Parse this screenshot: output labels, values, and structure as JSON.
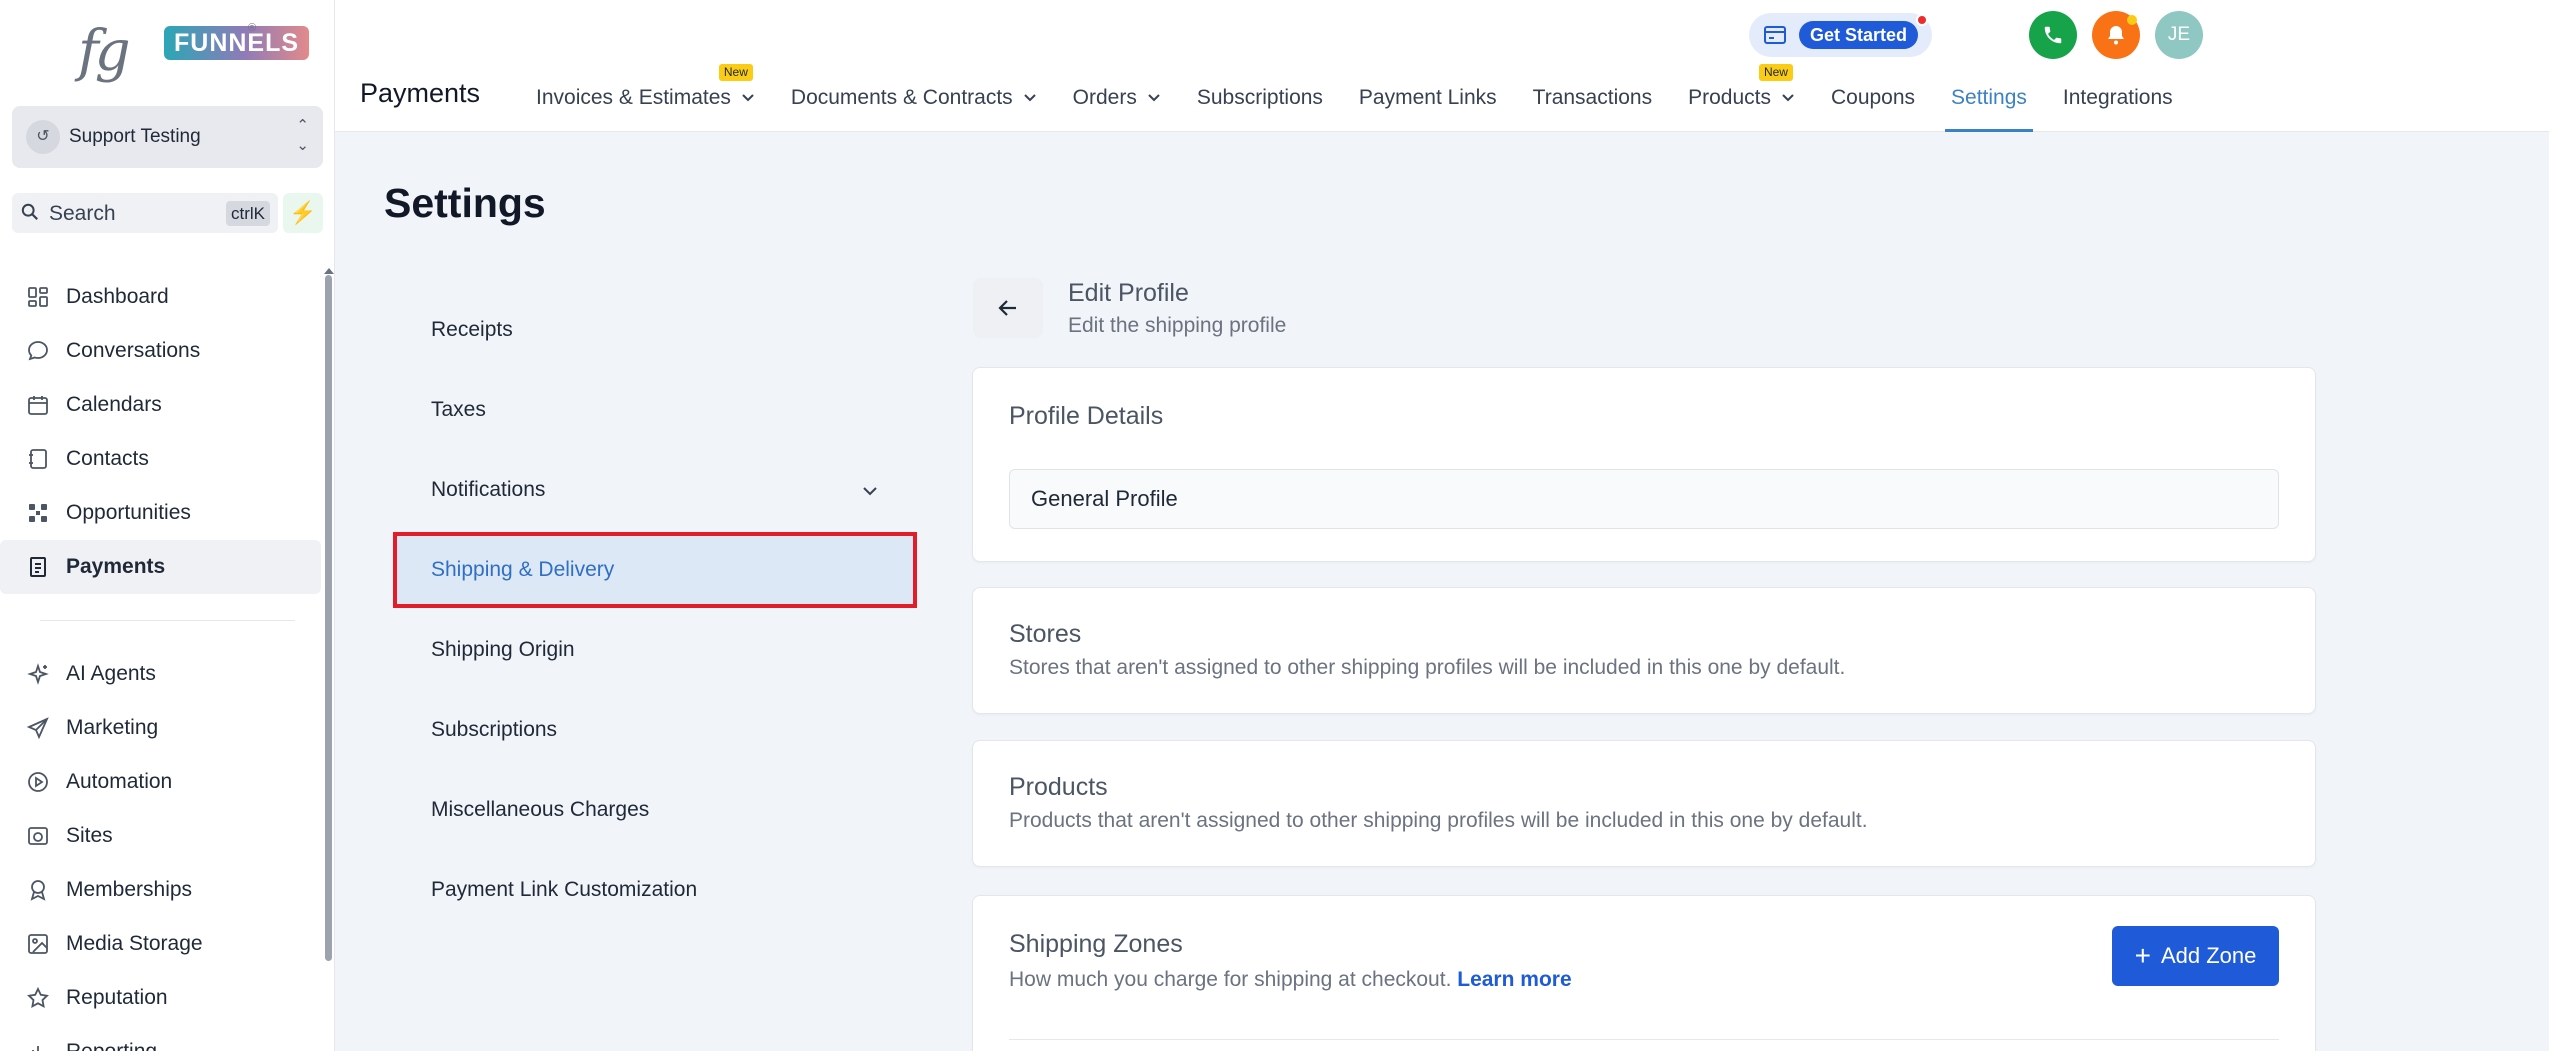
{
  "brand": {
    "logo_fg": "fg",
    "logo_word": "FUNNELS",
    "logo_reg": "®"
  },
  "account": {
    "name": "Support Testing",
    "avatar_glyph": "↺"
  },
  "search": {
    "label": "Search",
    "shortcut": "ctrlK"
  },
  "sidebar": {
    "items": [
      {
        "label": "Dashboard",
        "icon": "dashboard-icon"
      },
      {
        "label": "Conversations",
        "icon": "chat-bubble-icon"
      },
      {
        "label": "Calendars",
        "icon": "calendar-icon"
      },
      {
        "label": "Contacts",
        "icon": "contacts-book-icon"
      },
      {
        "label": "Opportunities",
        "icon": "opportunities-icon"
      },
      {
        "label": "Payments",
        "icon": "payments-icon",
        "active": true
      }
    ],
    "items2": [
      {
        "label": "AI Agents",
        "icon": "sparkle-icon"
      },
      {
        "label": "Marketing",
        "icon": "send-icon"
      },
      {
        "label": "Automation",
        "icon": "automation-icon"
      },
      {
        "label": "Sites",
        "icon": "globe-icon"
      },
      {
        "label": "Memberships",
        "icon": "badge-icon"
      },
      {
        "label": "Media Storage",
        "icon": "image-icon"
      },
      {
        "label": "Reputation",
        "icon": "star-icon"
      },
      {
        "label": "Reporting",
        "icon": "chart-icon"
      }
    ]
  },
  "topbar": {
    "module": "Payments",
    "tabs": [
      {
        "label": "Invoices & Estimates",
        "dropdown": true,
        "badge": "New"
      },
      {
        "label": "Documents & Contracts",
        "dropdown": true
      },
      {
        "label": "Orders",
        "dropdown": true
      },
      {
        "label": "Subscriptions"
      },
      {
        "label": "Payment Links"
      },
      {
        "label": "Transactions"
      },
      {
        "label": "Products",
        "dropdown": true,
        "badge": "New"
      },
      {
        "label": "Coupons"
      },
      {
        "label": "Settings",
        "active": true
      },
      {
        "label": "Integrations"
      }
    ],
    "get_started": "Get Started",
    "avatar": "JE"
  },
  "page": {
    "title": "Settings"
  },
  "settings_menu": [
    {
      "label": "Receipts"
    },
    {
      "label": "Taxes"
    },
    {
      "label": "Notifications",
      "expandable": true
    },
    {
      "label": "Shipping & Delivery",
      "active": true
    },
    {
      "label": "Shipping Origin"
    },
    {
      "label": "Subscriptions"
    },
    {
      "label": "Miscellaneous Charges"
    },
    {
      "label": "Payment Link Customization"
    }
  ],
  "edit_profile": {
    "title": "Edit Profile",
    "subtitle": "Edit the shipping profile"
  },
  "profile_details": {
    "title": "Profile Details",
    "value": "General Profile"
  },
  "stores": {
    "title": "Stores",
    "desc": "Stores that aren't assigned to other shipping profiles will be included in this one by default."
  },
  "products": {
    "title": "Products",
    "desc": "Products that aren't assigned to other shipping profiles will be included in this one by default."
  },
  "shipping_zones": {
    "title": "Shipping Zones",
    "desc": "How much you charge for shipping at checkout.",
    "learn_more": "Learn more",
    "add_button": "Add Zone"
  },
  "colors": {
    "accent": "#1f5bd8",
    "active_tab": "#3b82c4",
    "highlight_border": "#e11d2a",
    "active_menu_bg": "#dde8f7"
  }
}
